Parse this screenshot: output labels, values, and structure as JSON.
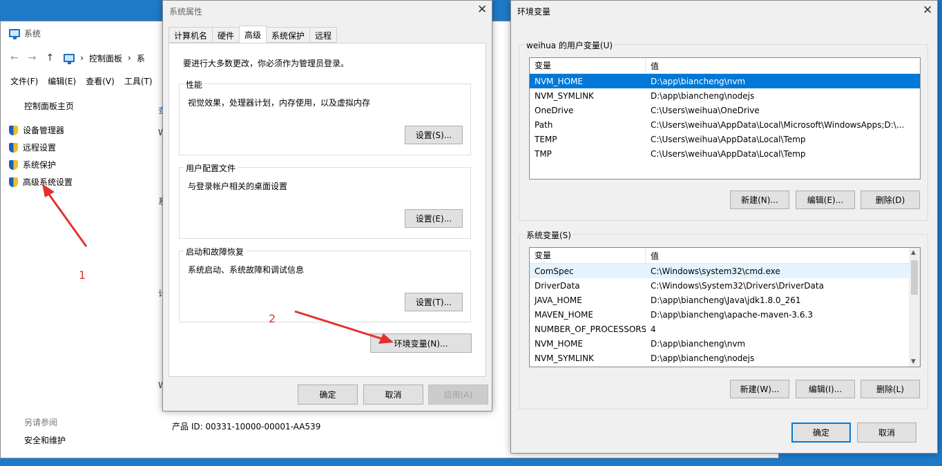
{
  "system_window": {
    "title": "系统",
    "breadcrumb": [
      "控制面板",
      "系"
    ],
    "menu": [
      "文件(F)",
      "编辑(E)",
      "查看(V)",
      "工具(T)"
    ],
    "home_link": "控制面板主页",
    "side_links": [
      "设备管理器",
      "远程设置",
      "系统保护",
      "高级系统设置"
    ],
    "see_also": "另请参阅",
    "security_link": "安全和维护",
    "product_id": "产品 ID: 00331-10000-00001-AA539",
    "partial_chars": [
      "查",
      "W",
      "系",
      "计",
      "W"
    ]
  },
  "system_properties": {
    "title": "系统属性",
    "tabs": [
      "计算机名",
      "硬件",
      "高级",
      "系统保护",
      "远程"
    ],
    "active_tab": "高级",
    "admin_note": "要进行大多数更改，你必须作为管理员登录。",
    "performance": {
      "legend": "性能",
      "desc": "视觉效果，处理器计划，内存使用，以及虚拟内存",
      "button": "设置(S)..."
    },
    "profiles": {
      "legend": "用户配置文件",
      "desc": "与登录帐户相关的桌面设置",
      "button": "设置(E)..."
    },
    "startup": {
      "legend": "启动和故障恢复",
      "desc": "系统启动、系统故障和调试信息",
      "button": "设置(T)..."
    },
    "env_button": "环境变量(N)...",
    "ok": "确定",
    "cancel": "取消",
    "apply": "应用(A)"
  },
  "env_variables": {
    "title": "环境变量",
    "user_group": "weihua 的用户变量(U)",
    "col_var": "变量",
    "col_val": "值",
    "user_vars": [
      {
        "name": "NVM_HOME",
        "value": "D:\\app\\biancheng\\nvm"
      },
      {
        "name": "NVM_SYMLINK",
        "value": "D:\\app\\biancheng\\nodejs"
      },
      {
        "name": "OneDrive",
        "value": "C:\\Users\\weihua\\OneDrive"
      },
      {
        "name": "Path",
        "value": "C:\\Users\\weihua\\AppData\\Local\\Microsoft\\WindowsApps;D:\\..."
      },
      {
        "name": "TEMP",
        "value": "C:\\Users\\weihua\\AppData\\Local\\Temp"
      },
      {
        "name": "TMP",
        "value": "C:\\Users\\weihua\\AppData\\Local\\Temp"
      }
    ],
    "user_buttons": {
      "new": "新建(N)...",
      "edit": "编辑(E)...",
      "delete": "删除(D)"
    },
    "system_group": "系统变量(S)",
    "system_vars": [
      {
        "name": "ComSpec",
        "value": "C:\\Windows\\system32\\cmd.exe"
      },
      {
        "name": "DriverData",
        "value": "C:\\Windows\\System32\\Drivers\\DriverData"
      },
      {
        "name": "JAVA_HOME",
        "value": "D:\\app\\biancheng\\Java\\jdk1.8.0_261"
      },
      {
        "name": "MAVEN_HOME",
        "value": "D:\\app\\biancheng\\apache-maven-3.6.3"
      },
      {
        "name": "NUMBER_OF_PROCESSORS",
        "value": "4"
      },
      {
        "name": "NVM_HOME",
        "value": "D:\\app\\biancheng\\nvm"
      },
      {
        "name": "NVM_SYMLINK",
        "value": "D:\\app\\biancheng\\nodejs"
      }
    ],
    "system_buttons": {
      "new": "新建(W)...",
      "edit": "编辑(I)...",
      "delete": "删除(L)"
    },
    "ok": "确定",
    "cancel": "取消"
  },
  "annotations": [
    "1",
    "2"
  ],
  "colors": {
    "desktop": "#1e7ac9",
    "selection": "#0078d7",
    "arrow": "#e4312b"
  }
}
